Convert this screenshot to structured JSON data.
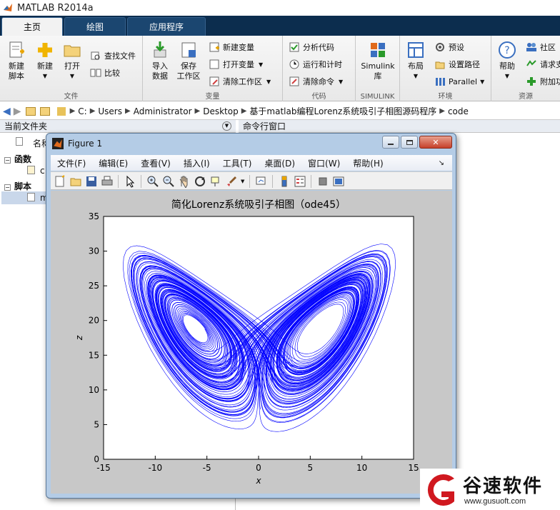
{
  "app": {
    "title": "MATLAB R2014a"
  },
  "tabs": [
    {
      "label": "主页"
    },
    {
      "label": "绘图"
    },
    {
      "label": "应用程序"
    }
  ],
  "ribbon": {
    "file": {
      "label": "文件",
      "new_script": "新建\n脚本",
      "new": "新建",
      "open": "打开",
      "find_files": "查找文件",
      "compare": "比较"
    },
    "variable": {
      "label": "变量",
      "import": "导入\n数据",
      "save_ws": "保存\n工作区",
      "new_var": "新建变量",
      "open_var": "打开变量",
      "clear_ws": "清除工作区"
    },
    "code": {
      "label": "代码",
      "analyze": "分析代码",
      "run_time": "运行和计时",
      "clear_cmd": "清除命令"
    },
    "simulink": {
      "label": "SIMULINK",
      "lib": "Simulink\n库"
    },
    "env": {
      "label": "环境",
      "layout": "布局",
      "prefs": "预设",
      "set_path": "设置路径",
      "parallel": "Parallel"
    },
    "resources": {
      "label": "资源",
      "help": "帮助",
      "community": "社区",
      "request": "请求支",
      "addons": "附加功"
    }
  },
  "address": {
    "segments": [
      "C:",
      "Users",
      "Administrator",
      "Desktop",
      "基于matlab编程Lorenz系统吸引子相图源码程序",
      "code"
    ]
  },
  "left_panel": {
    "title": "当前文件夹",
    "col_name": "名称",
    "group_functions": "函数",
    "group_scripts": "脚本",
    "item_c": "c",
    "item_m": "m"
  },
  "cmd_panel": {
    "title": "命令行窗口"
  },
  "figure": {
    "title": "Figure 1",
    "menus": [
      "文件(F)",
      "编辑(E)",
      "查看(V)",
      "插入(I)",
      "工具(T)",
      "桌面(D)",
      "窗口(W)",
      "帮助(H)"
    ]
  },
  "chart_data": {
    "type": "line",
    "title": "简化Lorenz系统吸引子相图（ode45）",
    "xlabel": "x",
    "ylabel": "z",
    "xlim": [
      -15,
      15
    ],
    "ylim": [
      0,
      35
    ],
    "xticks": [
      -15,
      -10,
      -5,
      0,
      5,
      10,
      15
    ],
    "yticks": [
      0,
      5,
      10,
      15,
      20,
      25,
      30,
      35
    ],
    "series": [
      {
        "color": "#0000ff",
        "description": "Lorenz attractor trajectory, two lobes centered near (-7.8, 19) and (7, 18)"
      }
    ],
    "grid": false
  },
  "watermark": {
    "brand": "谷速软件",
    "url": "www.gusuoft.com"
  }
}
